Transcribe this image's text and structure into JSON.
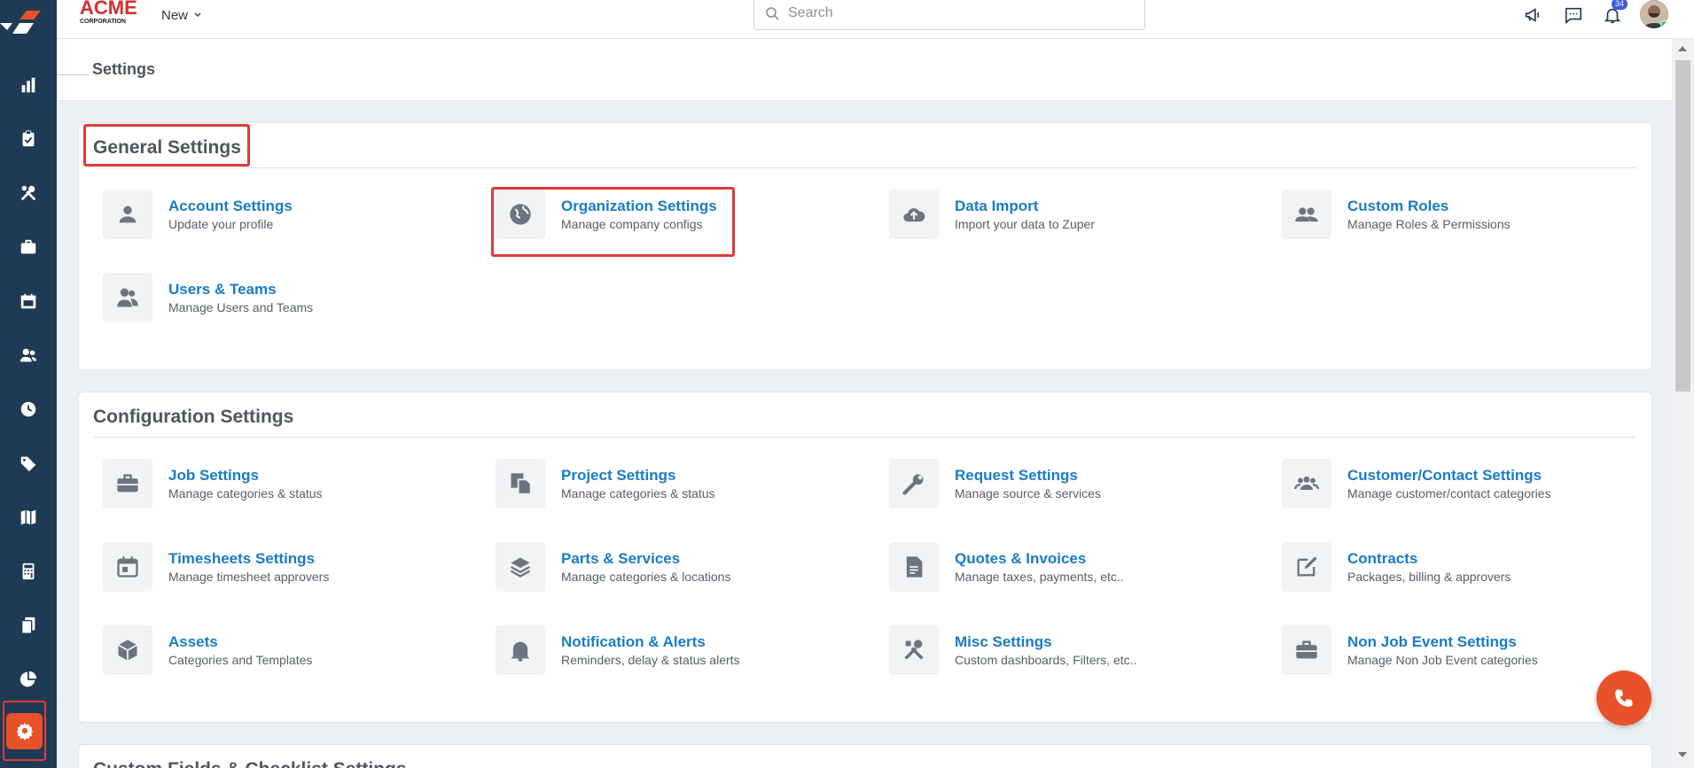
{
  "brand": {
    "name": "ACME",
    "sub": "CORPORATION"
  },
  "topbar": {
    "new_label": "New",
    "search_placeholder": "Search",
    "notification_count": "34"
  },
  "page": {
    "title": "Settings"
  },
  "sections": {
    "general": {
      "title": "General Settings",
      "items": [
        {
          "title": "Account Settings",
          "desc": "Update your profile",
          "icon": "person-icon"
        },
        {
          "title": "Organization Settings",
          "desc": "Manage company configs",
          "icon": "globe-icon"
        },
        {
          "title": "Data Import",
          "desc": "Import your data to Zuper",
          "icon": "cloud-upload-icon"
        },
        {
          "title": "Custom Roles",
          "desc": "Manage Roles & Permissions",
          "icon": "group-icon"
        },
        {
          "title": "Users & Teams",
          "desc": "Manage Users and Teams",
          "icon": "users-icon"
        }
      ]
    },
    "configuration": {
      "title": "Configuration Settings",
      "items": [
        {
          "title": "Job Settings",
          "desc": "Manage categories & status",
          "icon": "briefcase-icon"
        },
        {
          "title": "Project Settings",
          "desc": "Manage categories & status",
          "icon": "project-icon"
        },
        {
          "title": "Request Settings",
          "desc": "Manage source & services",
          "icon": "wrench-icon"
        },
        {
          "title": "Customer/Contact Settings",
          "desc": "Manage customer/contact categories",
          "icon": "contacts-icon"
        },
        {
          "title": "Timesheets Settings",
          "desc": "Manage timesheet approvers",
          "icon": "calendar-icon"
        },
        {
          "title": "Parts & Services",
          "desc": "Manage categories & locations",
          "icon": "layers-icon"
        },
        {
          "title": "Quotes & Invoices",
          "desc": "Manage taxes, payments, etc..",
          "icon": "document-icon"
        },
        {
          "title": "Contracts",
          "desc": "Packages, billing & approvers",
          "icon": "edit-icon"
        },
        {
          "title": "Assets",
          "desc": "Categories and Templates",
          "icon": "box-icon"
        },
        {
          "title": "Notification & Alerts",
          "desc": "Reminders, delay & status alerts",
          "icon": "bell-icon"
        },
        {
          "title": "Misc Settings",
          "desc": "Custom dashboards, Filters, etc..",
          "icon": "tools-icon"
        },
        {
          "title": "Non Job Event Settings",
          "desc": "Manage Non Job Event categories",
          "icon": "briefcase-icon"
        }
      ]
    },
    "custom_fields": {
      "title": "Custom Fields & Checklist Settings"
    }
  },
  "sidebar": {
    "items": [
      "dashboard-icon",
      "clipboard-icon",
      "tools-icon",
      "briefcase-icon",
      "calendar-icon",
      "users-icon",
      "clock-icon",
      "tag-icon",
      "map-icon",
      "calculator-icon",
      "documents-icon",
      "pie-chart-icon",
      "gear-icon"
    ],
    "active": "gear-icon"
  },
  "colors": {
    "sidebar": "#1f3a55",
    "accent": "#e8512a",
    "link": "#1a7bc7",
    "highlight": "#e03a3a"
  }
}
